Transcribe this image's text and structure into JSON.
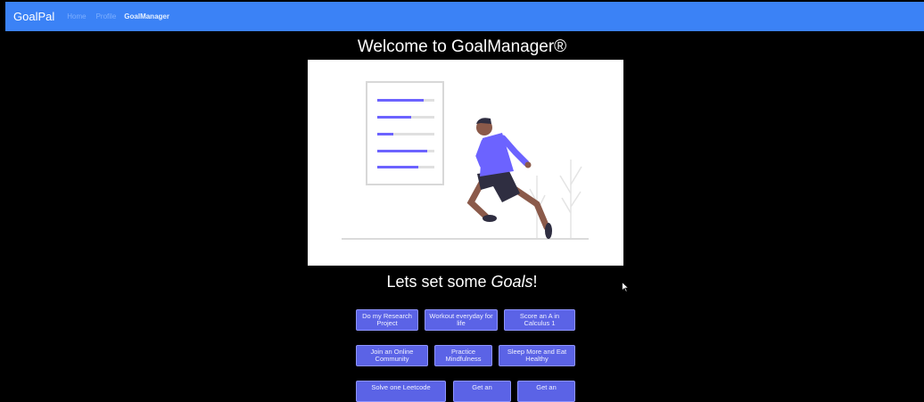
{
  "navbar": {
    "brand": "GoalPal",
    "links": [
      {
        "label": "Home"
      },
      {
        "label": "Profile"
      },
      {
        "label": "GoalManager"
      }
    ]
  },
  "main": {
    "title": "Welcome to GoalManager®",
    "subtitle_prefix": "Lets set some ",
    "subtitle_emphasis": "Goals",
    "subtitle_suffix": "!",
    "goals": [
      "Do my Research Project",
      "Workout everyday for life",
      "Score an A in Calculus 1",
      "Join an Online Community",
      "Practice Mindfulness",
      "Sleep More and Eat Healthy",
      "Solve one Leetcode",
      "Get an",
      "Get an"
    ]
  },
  "colors": {
    "navbar": "#3b82f6",
    "button": "#5b63e6",
    "illustration_accent": "#6c63ff"
  }
}
